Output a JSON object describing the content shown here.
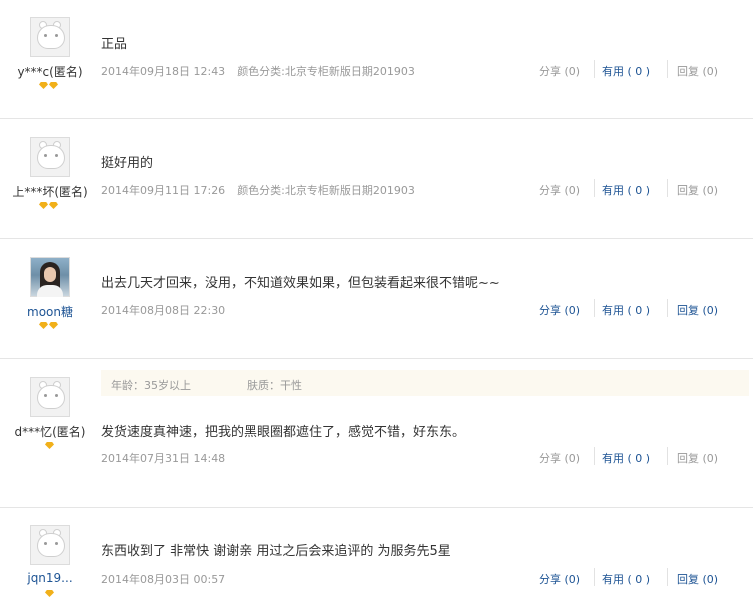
{
  "reviews": [
    {
      "user": "y***c(匿名)",
      "avatar": "default-avatar",
      "content": "正品",
      "date": "2014年09月18日 12:43",
      "spec": "颜色分类:北京专柜新版日期201903",
      "share": "分享 (0)",
      "useful": "有用 ( 0 )",
      "reply": "回复 (0)"
    },
    {
      "user": "上***坏(匿名)",
      "avatar": "default-avatar",
      "content": "挺好用的",
      "date": "2014年09月11日 17:26",
      "spec": "颜色分类:北京专柜新版日期201903",
      "share": "分享 (0)",
      "useful": "有用 ( 0 )",
      "reply": "回复 (0)"
    },
    {
      "user": "moon糖",
      "avatar": "photo-avatar",
      "content": "出去几天才回来，没用，不知道效果如果，但包装看起来很不错呢~~",
      "date": "2014年08月08日 22:30",
      "spec": "",
      "share": "分享 (0)",
      "useful": "有用 ( 0 )",
      "reply": "回复 (0)"
    },
    {
      "user": "d***忆(匿名)",
      "avatar": "default-avatar",
      "attributes": [
        "年龄：35岁以上",
        "肤质：干性"
      ],
      "content": "发货速度真神速，把我的黑眼圈都遮住了，感觉不错，好东东。",
      "date": "2014年07月31日 14:48",
      "spec": "",
      "share": "分享 (0)",
      "useful": "有用 ( 0 )",
      "reply": "回复 (0)"
    },
    {
      "user": "jqn19...",
      "avatar": "default-avatar",
      "content": "东西收到了 非常快 谢谢亲 用过之后会来追评的 为服务先5星",
      "date": "2014年08月03日 00:57",
      "spec": "",
      "share": "分享 (0)",
      "useful": "有用 ( 0 )",
      "reply": "回复 (0)"
    }
  ],
  "colors": {
    "link": "#1e5494",
    "muted": "#999999",
    "badge": "#f1b01a",
    "attr_bg": "#fcf9f0"
  }
}
